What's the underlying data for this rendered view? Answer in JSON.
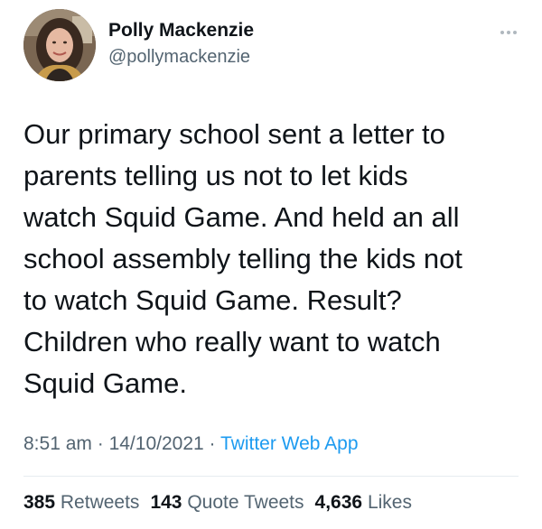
{
  "author": {
    "name": "Polly Mackenzie",
    "handle": "@pollymackenzie"
  },
  "tweet": {
    "text": "Our primary school sent a letter to\nparents telling us not to let kids\nwatch Squid Game. And held an all\nschool assembly telling the kids not\nto watch Squid Game. Result?\nChildren who really want to watch\nSquid Game.",
    "time": "8:51 am",
    "separator1": "·",
    "date": "14/10/2021",
    "separator2": "·",
    "source": "Twitter Web App"
  },
  "stats": {
    "retweets_count": "385",
    "retweets_label": "Retweets",
    "quotes_count": "143",
    "quotes_label": "Quote Tweets",
    "likes_count": "4,636",
    "likes_label": "Likes"
  },
  "icons": {
    "more": "more-dots-icon",
    "avatar": "profile-photo"
  },
  "colors": {
    "text": "#0f1419",
    "secondary": "#536471",
    "link": "#1d9bf0",
    "divider": "#e6ecf0"
  }
}
